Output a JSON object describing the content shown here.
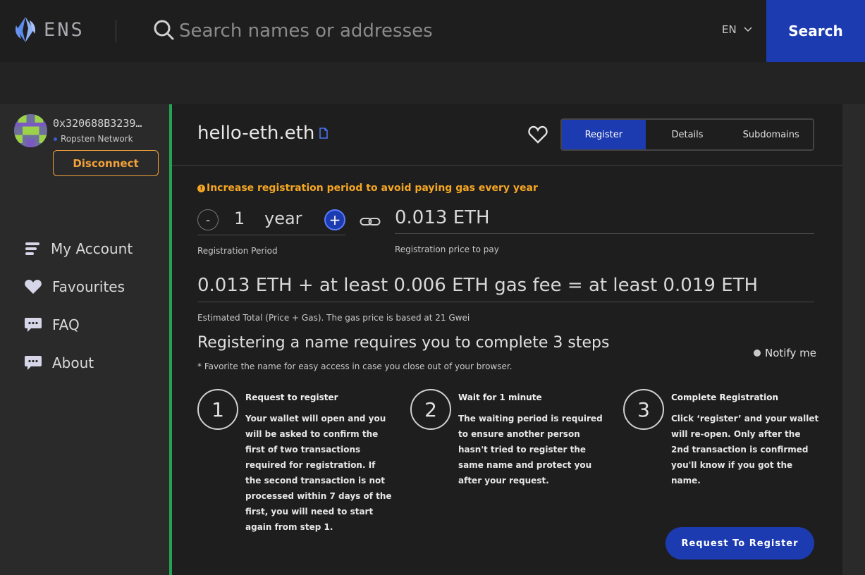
{
  "header": {
    "logo_text": "ENS",
    "search_placeholder": "Search names or addresses",
    "language": "EN",
    "search_button": "Search"
  },
  "sidebar": {
    "address": "0x320688B3239…",
    "network": "Ropsten Network",
    "disconnect_label": "Disconnect",
    "nav": [
      {
        "label": "My Account",
        "icon": "account-icon"
      },
      {
        "label": "Favourites",
        "icon": "heart-icon"
      },
      {
        "label": "FAQ",
        "icon": "chat-icon"
      },
      {
        "label": "About",
        "icon": "chat-icon"
      }
    ]
  },
  "main": {
    "domain": "hello-eth.eth",
    "tabs": [
      {
        "label": "Register",
        "active": true
      },
      {
        "label": "Details",
        "active": false
      },
      {
        "label": "Subdomains",
        "active": false
      }
    ],
    "warning": "Increase registration period to avoid paying gas every year",
    "period_minus": "-",
    "period_value": "1",
    "period_unit": "year",
    "period_plus": "+",
    "period_label": "Registration Period",
    "price": "0.013 ETH",
    "price_label": "Registration price to pay",
    "total": "0.013 ETH + at least 0.006 ETH gas fee = at least 0.019 ETH",
    "total_label": "Estimated Total (Price + Gas). The gas price is based at 21 Gwei",
    "steps_title": "Registering a name requires you to complete 3 steps",
    "notify_label": "Notify me",
    "favorite_note": "* Favorite the name for easy access in case you close out of your browser.",
    "steps": [
      {
        "number": "1",
        "title": "Request to register",
        "text": "Your wallet will open and you will be asked to confirm the first of two transactions required for registration. If the second transaction is not processed within 7 days of the first, you will need to start again from step 1."
      },
      {
        "number": "2",
        "title": "Wait for 1 minute",
        "text": "The waiting period is required to ensure another person hasn't tried to register the same name and protect you after your request."
      },
      {
        "number": "3",
        "title": "Complete Registration",
        "text": "Click ‘register’ and your wallet will re-open. Only after the 2nd transaction is confirmed you'll know if you got the name."
      }
    ],
    "request_button": "Request To Register"
  },
  "colors": {
    "accent": "#1c3bb0",
    "warning": "#f5a623",
    "disconnect": "#f2a23a",
    "success_border": "#23a455"
  }
}
